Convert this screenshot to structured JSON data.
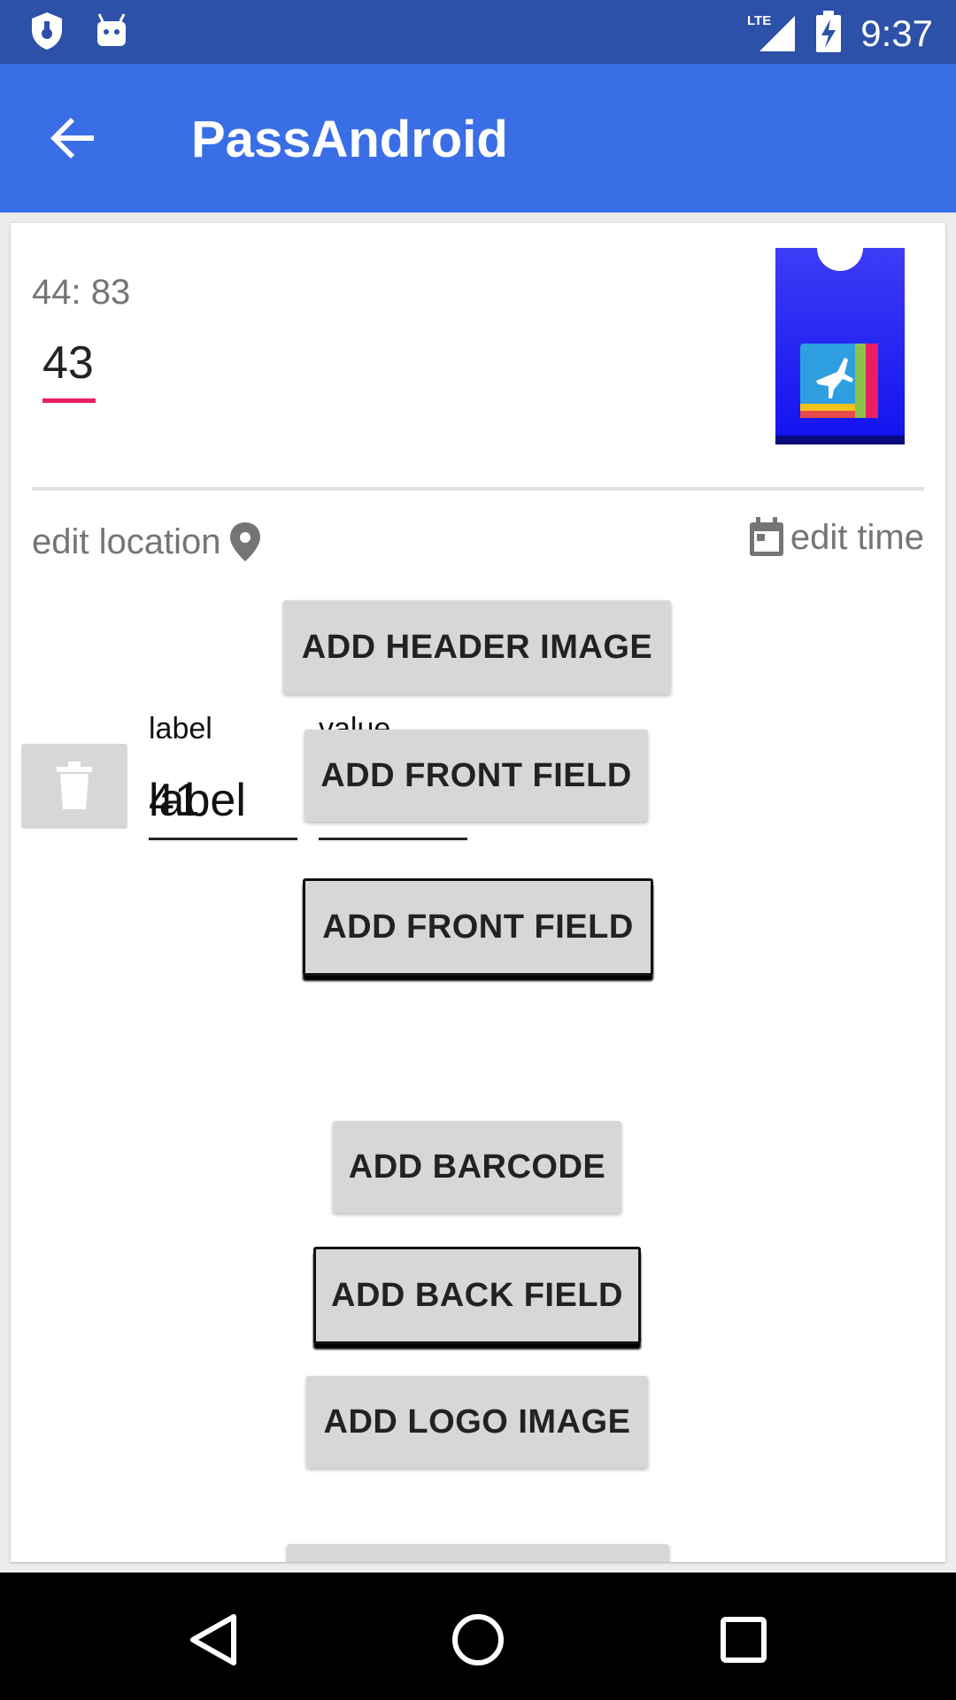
{
  "status_bar": {
    "time": "9:37",
    "network": "LTE",
    "icons": [
      "shield-icon",
      "android-icon",
      "signal-icon",
      "battery-charging-icon"
    ]
  },
  "app_bar": {
    "title": "PassAndroid",
    "back_icon": "arrow-back-icon"
  },
  "pass": {
    "label": "44: 83",
    "value": "43",
    "thumbnail_icon": "airplane-pass-icon"
  },
  "actions": {
    "edit_location": "edit location",
    "edit_time": "edit time"
  },
  "buttons": {
    "add_header_image": "ADD HEADER IMAGE",
    "add_front_field_1": "ADD FRONT FIELD",
    "add_front_field_2": "ADD FRONT FIELD",
    "add_barcode": "ADD BARCODE",
    "add_back_field": "ADD BACK FIELD",
    "add_logo_image": "ADD LOGO IMAGE"
  },
  "field_row": {
    "label_caption": "label",
    "label_value": "label",
    "label_overlap": "41",
    "value_caption": "value"
  },
  "colors": {
    "status_bar": "#2d50a8",
    "app_bar": "#3a6ee6",
    "accent": "#e91e63",
    "button": "#d6d7d7"
  }
}
